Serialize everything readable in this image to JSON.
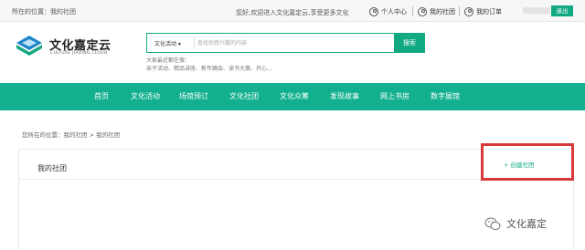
{
  "topbar": {
    "location_prefix": "所在的位置：",
    "location_value": "我的社团",
    "welcome": "您好,欢迎进入文化嘉定云,享受更多文化",
    "personal_center": "个人中心",
    "my_club": "我的社团",
    "my_order": "我的订单",
    "logout": "退出"
  },
  "logo": {
    "name": "文化嘉定云",
    "subtitle": "CULTURE JIADING CLOUD"
  },
  "search": {
    "category": "文化活动 ▾",
    "placeholder": "查找你感兴趣的内容",
    "button": "搜索",
    "hot_label": "大家最近都在搜：",
    "hot_terms": "亲子活动、精品讲座、新年踊会、读书大赛、开心..."
  },
  "nav": [
    {
      "label": "首页"
    },
    {
      "label": "文化活动"
    },
    {
      "label": "场馆预订"
    },
    {
      "label": "文化社团"
    },
    {
      "label": "文化众筹"
    },
    {
      "label": "发现故事"
    },
    {
      "label": "网上书房"
    },
    {
      "label": "数字展馆"
    }
  ],
  "breadcrumb": "您所在的位置：我的社团 > 我的社团",
  "panel": {
    "title": "我的社团",
    "create_label": "+ 创建社团"
  },
  "watermark": "文化嘉定",
  "colors": {
    "accent": "#11a982",
    "nav_bg": "#12b08e",
    "highlight": "#d9393a"
  }
}
